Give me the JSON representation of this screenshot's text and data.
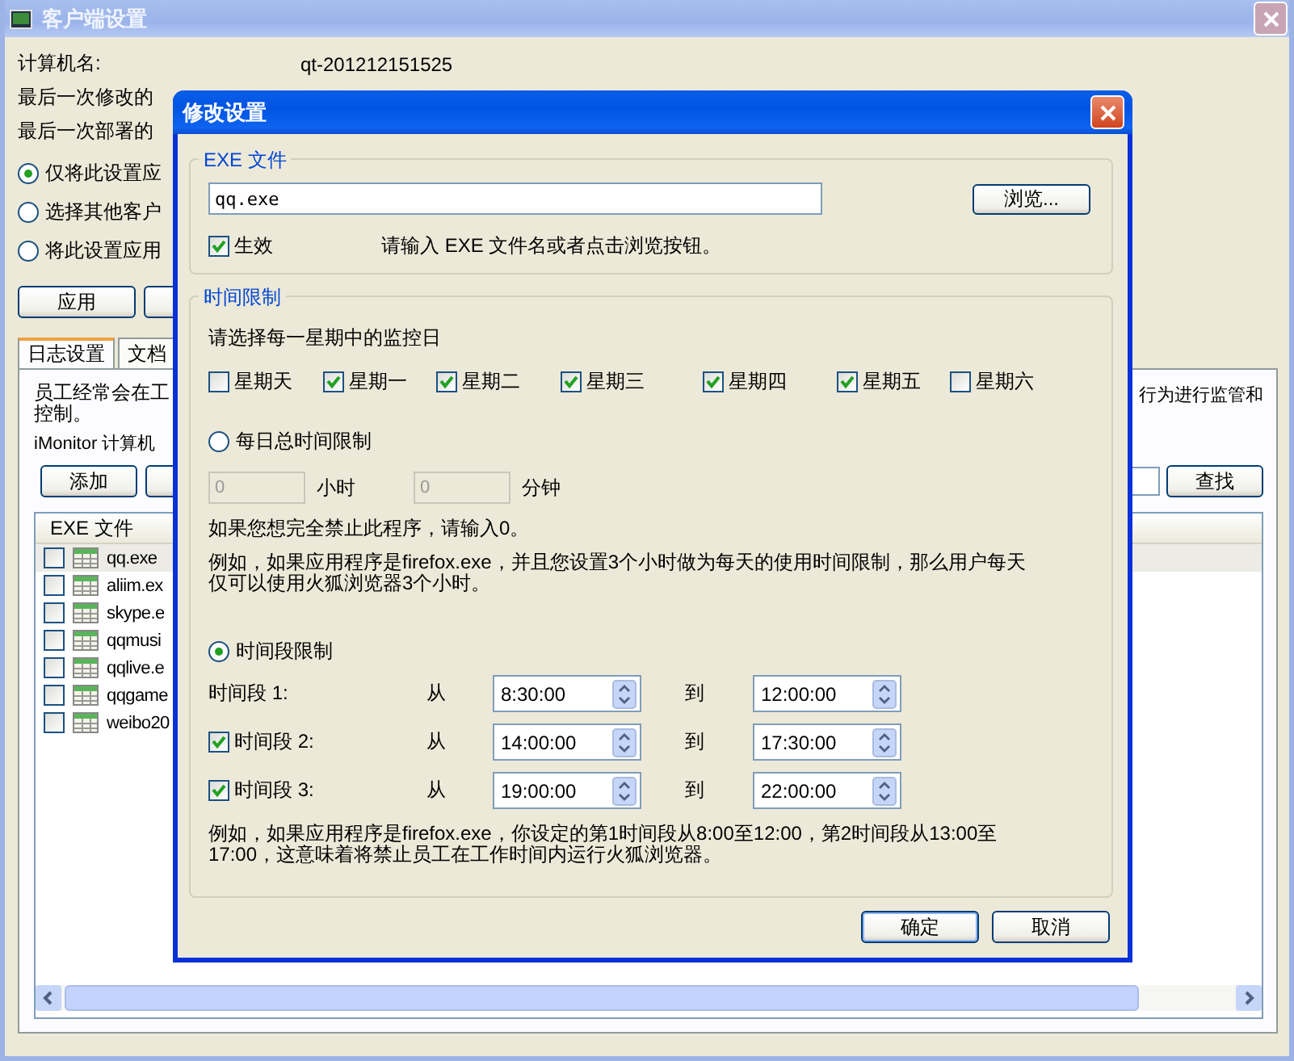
{
  "window": {
    "title": "客户端设置"
  },
  "info": [
    {
      "label": "计算机名:",
      "value": "qt-201212151525"
    },
    {
      "label": "最后一次修改的"
    },
    {
      "label": "最后一次部署的"
    }
  ],
  "scope_options": [
    {
      "label": "仅将此设置应",
      "selected": true
    },
    {
      "label": "选择其他客户",
      "selected": false
    },
    {
      "label": "将此设置应用",
      "selected": false
    }
  ],
  "action_buttons": [
    "应用"
  ],
  "tabs": [
    {
      "label": "日志设置",
      "selected": true
    },
    {
      "label": "文档",
      "selected": false
    }
  ],
  "panel": {
    "description_left": [
      "员工经常会在工",
      "控制。"
    ],
    "description_right": "行为进行监管和",
    "product_line": "iMonitor 计算机",
    "buttons": [
      "添加"
    ],
    "search_button": "查找",
    "list": {
      "column": "EXE 文件",
      "rows": [
        {
          "name": "qq.exe",
          "checked": false,
          "selected": true
        },
        {
          "name": "aliim.ex",
          "checked": false,
          "selected": false
        },
        {
          "name": "skype.e",
          "checked": false,
          "selected": false
        },
        {
          "name": "qqmusi",
          "checked": false,
          "selected": false
        },
        {
          "name": "qqlive.e",
          "checked": false,
          "selected": false
        },
        {
          "name": "qqgame",
          "checked": false,
          "selected": false
        },
        {
          "name": "weibo20",
          "checked": false,
          "selected": false
        }
      ]
    }
  },
  "dialog": {
    "title": "修改设置",
    "exe_group": {
      "legend": "EXE 文件",
      "value": "qq.exe",
      "browse_button": "浏览...",
      "enabled": {
        "label": "生效",
        "checked": true
      },
      "hint": "请输入 EXE 文件名或者点击浏览按钮。"
    },
    "time_group": {
      "legend": "时间限制",
      "days_prompt": "请选择每一星期中的监控日",
      "days": [
        {
          "label": "星期天",
          "checked": false
        },
        {
          "label": "星期一",
          "checked": true
        },
        {
          "label": "星期二",
          "checked": true
        },
        {
          "label": "星期三",
          "checked": true
        },
        {
          "label": "星期四",
          "checked": true
        },
        {
          "label": "星期五",
          "checked": true
        },
        {
          "label": "星期六",
          "checked": false
        }
      ],
      "daily": {
        "label": "每日总时间限制",
        "selected": false,
        "hours": "0",
        "hours_unit": "小时",
        "minutes": "0",
        "minutes_unit": "分钟"
      },
      "ban_note": "如果您想完全禁止此程序，请输入0。",
      "daily_example": [
        "例如，如果应用程序是firefox.exe，并且您设置3个小时做为每天的使用时间限制，那么用户每天",
        "仅可以使用火狐浏览器3个小时。"
      ],
      "periods": {
        "label": "时间段限制",
        "selected": true,
        "rows": [
          {
            "kind": "label",
            "label": "时间段 1:",
            "from_label": "从",
            "from": "8:30:00",
            "to_label": "到",
            "to": "12:00:00"
          },
          {
            "kind": "checkbox",
            "checked": true,
            "label": "时间段 2:",
            "from_label": "从",
            "from": "14:00:00",
            "to_label": "到",
            "to": "17:30:00"
          },
          {
            "kind": "checkbox",
            "checked": true,
            "label": "时间段 3:",
            "from_label": "从",
            "from": "19:00:00",
            "to_label": "到",
            "to": "22:00:00"
          }
        ]
      },
      "periods_example": [
        "例如，如果应用程序是firefox.exe，你设定的第1时间段从8:00至12:00，第2时间段从13:00至",
        "17:00，这意味着将禁止员工在工作时间内运行火狐浏览器。"
      ]
    },
    "buttons": [
      "确定",
      "取消"
    ]
  }
}
